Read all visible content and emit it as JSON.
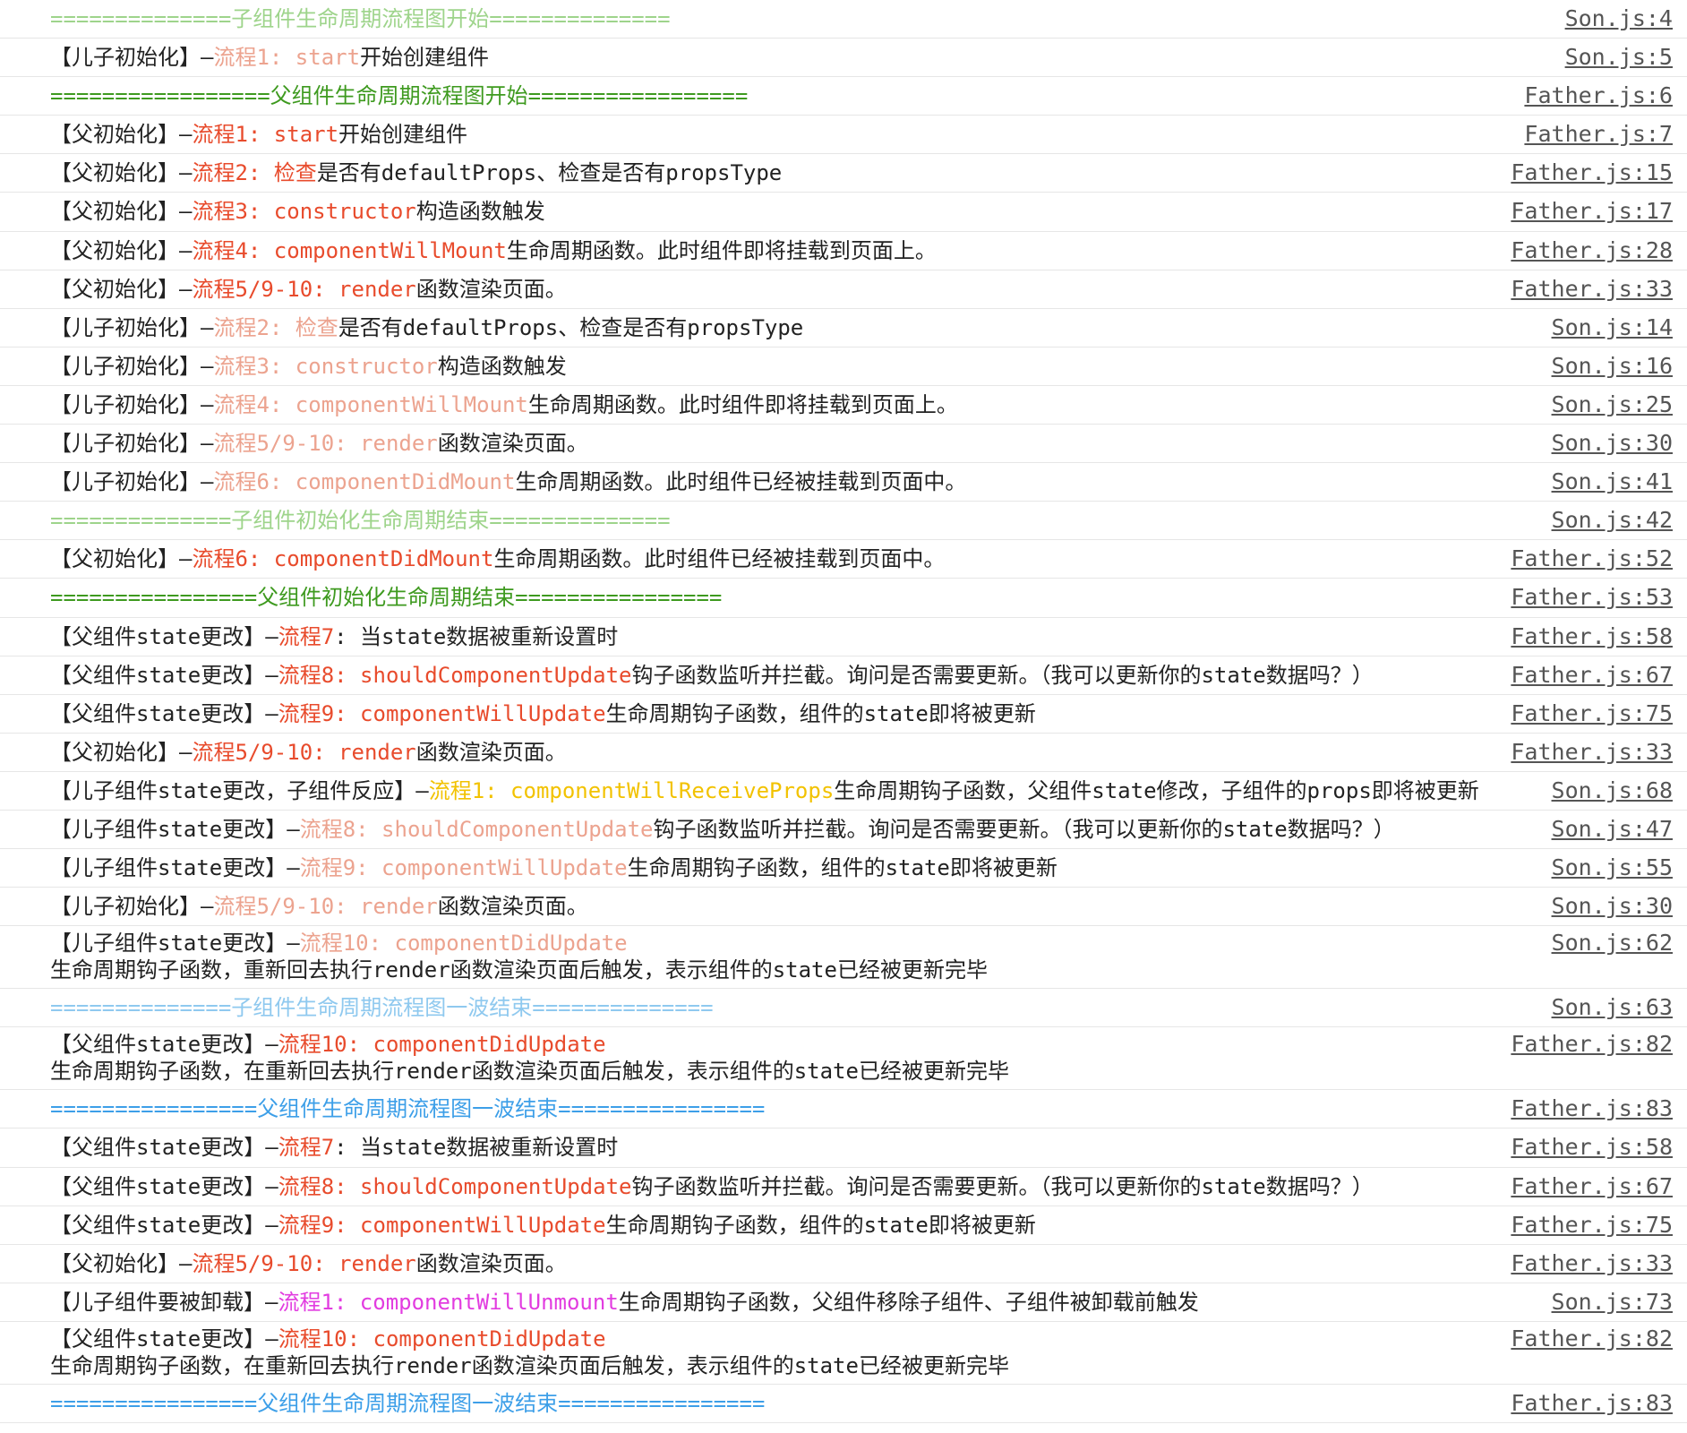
{
  "colors": {
    "green_light": "#9ed48b",
    "green_dark": "#3e9a1f",
    "blue_light": "#8fc9ef",
    "blue": "#3d9fe8",
    "red": "#e84b2c",
    "pink": "#eca38f",
    "yellow": "#f2c200",
    "magenta": "#e23ce0",
    "text": "#222222",
    "text_light": "#333333"
  },
  "console": {
    "rows": [
      {
        "text": "==============子组件生命周期流程图开始==============",
        "color": "green_light",
        "source": "Son.js:4"
      },
      {
        "prefix": "【儿子初始化】—",
        "step": "流程1: start",
        "step_color": "pink",
        "desc": "开始创建组件",
        "source": "Son.js:5"
      },
      {
        "text": "=================父组件生命周期流程图开始=================",
        "color": "green_dark",
        "source": "Father.js:6"
      },
      {
        "prefix": "【父初始化】—",
        "step": "流程1: start",
        "step_color": "red",
        "desc": "开始创建组件",
        "source": "Father.js:7"
      },
      {
        "prefix": "【父初始化】—",
        "step": "流程2: 检查",
        "step_color": "red",
        "desc": "是否有defaultProps、检查是否有propsType",
        "source": "Father.js:15"
      },
      {
        "prefix": "【父初始化】—",
        "step": "流程3: constructor",
        "step_color": "red",
        "desc": "构造函数触发",
        "source": "Father.js:17"
      },
      {
        "prefix": "【父初始化】—",
        "step": "流程4: componentWillMount",
        "step_color": "red",
        "desc": "生命周期函数。此时组件即将挂载到页面上。",
        "source": "Father.js:28"
      },
      {
        "prefix": "【父初始化】—",
        "step": "流程5/9-10: render",
        "step_color": "red",
        "desc": "函数渲染页面。",
        "source": "Father.js:33"
      },
      {
        "prefix": "【儿子初始化】—",
        "step": "流程2: 检查",
        "step_color": "pink",
        "desc": "是否有defaultProps、检查是否有propsType",
        "source": "Son.js:14"
      },
      {
        "prefix": "【儿子初始化】—",
        "step": "流程3: constructor",
        "step_color": "pink",
        "desc": "构造函数触发",
        "source": "Son.js:16"
      },
      {
        "prefix": "【儿子初始化】—",
        "step": "流程4: componentWillMount",
        "step_color": "pink",
        "desc": "生命周期函数。此时组件即将挂载到页面上。",
        "source": "Son.js:25"
      },
      {
        "prefix": "【儿子初始化】—",
        "step": "流程5/9-10: render",
        "step_color": "pink",
        "desc": "函数渲染页面。",
        "source": "Son.js:30"
      },
      {
        "prefix": "【儿子初始化】—",
        "step": "流程6: componentDidMount",
        "step_color": "pink",
        "desc": "生命周期函数。此时组件已经被挂载到页面中。",
        "source": "Son.js:41"
      },
      {
        "text": "==============子组件初始化生命周期结束==============",
        "color": "green_light",
        "source": "Son.js:42"
      },
      {
        "prefix": "【父初始化】—",
        "step": "流程6: componentDidMount",
        "step_color": "red",
        "desc": "生命周期函数。此时组件已经被挂载到页面中。",
        "source": "Father.js:52"
      },
      {
        "text": "================父组件初始化生命周期结束================",
        "color": "green_dark",
        "source": "Father.js:53"
      },
      {
        "prefix": "【父组件state更改】—",
        "step": "流程7",
        "step_color": "red",
        "desc": ": 当state数据被重新设置时",
        "source": "Father.js:58"
      },
      {
        "prefix": "【父组件state更改】—",
        "step": "流程8: shouldComponentUpdate",
        "step_color": "red",
        "desc": "钩子函数监听并拦截。询问是否需要更新。（我可以更新你的state数据吗？）",
        "source": "Father.js:67"
      },
      {
        "prefix": "【父组件state更改】—",
        "step": "流程9: componentWillUpdate",
        "step_color": "red",
        "desc": "生命周期钩子函数，组件的state即将被更新",
        "source": "Father.js:75"
      },
      {
        "prefix": "【父初始化】—",
        "step": "流程5/9-10: render",
        "step_color": "red",
        "desc": "函数渲染页面。",
        "source": "Father.js:33"
      },
      {
        "prefix": "【儿子组件state更改，子组件反应】—",
        "step": "流程1: componentWillReceiveProps",
        "step_color": "yellow",
        "desc": "生命周期钩子函数，父组件state修改，子组件的props即将被更新",
        "source": "Son.js:68"
      },
      {
        "prefix": "【儿子组件state更改】—",
        "step": "流程8: shouldComponentUpdate",
        "step_color": "pink",
        "desc": "钩子函数监听并拦截。询问是否需要更新。（我可以更新你的state数据吗？）",
        "source": "Son.js:47"
      },
      {
        "prefix": "【儿子组件state更改】—",
        "step": "流程9: componentWillUpdate",
        "step_color": "pink",
        "desc": "生命周期钩子函数，组件的state即将被更新",
        "source": "Son.js:55"
      },
      {
        "prefix": "【儿子初始化】—",
        "step": "流程5/9-10: render",
        "step_color": "pink",
        "desc": "函数渲染页面。",
        "source": "Son.js:30"
      },
      {
        "prefix": "【儿子组件state更改】—",
        "step": "流程10: componentDidUpdate",
        "step_color": "pink",
        "line2": "生命周期钩子函数，重新回去执行render函数渲染页面后触发，表示组件的state已经被更新完毕",
        "source": "Son.js:62"
      },
      {
        "text": "==============子组件生命周期流程图一波结束==============",
        "color": "blue_light",
        "source": "Son.js:63"
      },
      {
        "prefix": "【父组件state更改】—",
        "step": "流程10: componentDidUpdate",
        "step_color": "red",
        "line2": "生命周期钩子函数，在重新回去执行render函数渲染页面后触发，表示组件的state已经被更新完毕",
        "source": "Father.js:82"
      },
      {
        "text": "================父组件生命周期流程图一波结束================",
        "color": "blue",
        "source": "Father.js:83"
      },
      {
        "prefix": "【父组件state更改】—",
        "step": "流程7",
        "step_color": "red",
        "desc": ": 当state数据被重新设置时",
        "source": "Father.js:58"
      },
      {
        "prefix": "【父组件state更改】—",
        "step": "流程8: shouldComponentUpdate",
        "step_color": "red",
        "desc": "钩子函数监听并拦截。询问是否需要更新。（我可以更新你的state数据吗？）",
        "source": "Father.js:67"
      },
      {
        "prefix": "【父组件state更改】—",
        "step": "流程9: componentWillUpdate",
        "step_color": "red",
        "desc": "生命周期钩子函数，组件的state即将被更新",
        "source": "Father.js:75"
      },
      {
        "prefix": "【父初始化】—",
        "step": "流程5/9-10: render",
        "step_color": "red",
        "desc": "函数渲染页面。",
        "source": "Father.js:33"
      },
      {
        "prefix": "【儿子组件要被卸载】—",
        "step": "流程1: componentWillUnmount",
        "step_color": "magenta",
        "desc": "生命周期钩子函数，父组件移除子组件、子组件被卸载前触发",
        "source": "Son.js:73"
      },
      {
        "prefix": "【父组件state更改】—",
        "step": "流程10: componentDidUpdate",
        "step_color": "red",
        "line2": "生命周期钩子函数，在重新回去执行render函数渲染页面后触发，表示组件的state已经被更新完毕",
        "source": "Father.js:82"
      },
      {
        "text": "================父组件生命周期流程图一波结束================",
        "color": "blue",
        "source": "Father.js:83"
      }
    ]
  }
}
